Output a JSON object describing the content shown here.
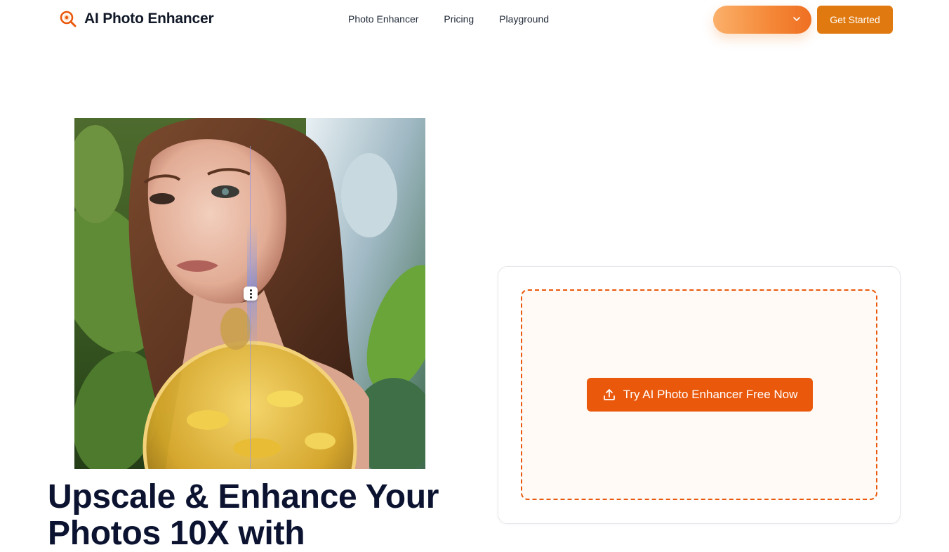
{
  "brand": {
    "name": "AI Photo Enhancer",
    "logo_icon": "magnifier-logo-icon",
    "accent": "#ea580c"
  },
  "nav": {
    "items": [
      "Photo Enhancer",
      "Pricing",
      "Playground"
    ]
  },
  "header": {
    "language_select_icon": "chevron-down-icon",
    "cta_label": "Get Started"
  },
  "hero": {
    "image_alt": "Before/after comparison of a woman's portrait among leaves",
    "compare_handle_icon": "more-vertical-icon",
    "headline": "Upscale & Enhance Your Photos 10X with"
  },
  "upload": {
    "button_label": "Try AI Photo Enhancer Free Now",
    "button_icon": "upload-icon"
  },
  "colors": {
    "button_orange": "#ea580c",
    "cta_orange": "#e07a10",
    "heading": "#0b1330"
  }
}
